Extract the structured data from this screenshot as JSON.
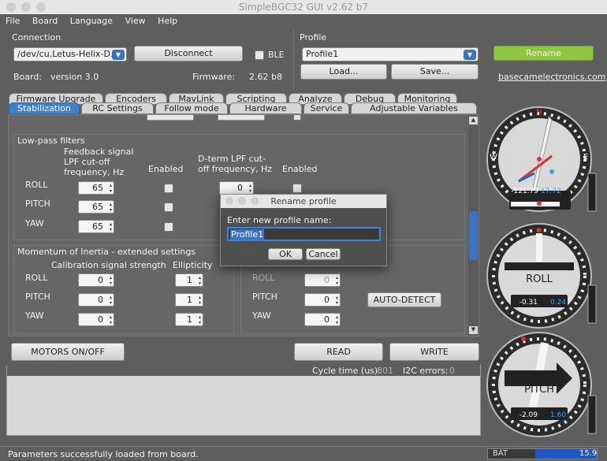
{
  "window": {
    "title": "SimpleBGC32 GUI v2.62 b7"
  },
  "menu": [
    "File",
    "Board",
    "Language",
    "View",
    "Help"
  ],
  "connection": {
    "label": "Connection",
    "port": "/dev/cu.Letus-Helix-D...",
    "disconnect": "Disconnect",
    "ble": "BLE",
    "board_label": "Board:",
    "board_value": "version 3.0",
    "firmware_label": "Firmware:",
    "firmware_value": "2.62 b8"
  },
  "profile": {
    "label": "Profile",
    "value": "Profile1",
    "load": "Load...",
    "save": "Save...",
    "rename": "Rename",
    "link": "basecamelectronics.com"
  },
  "tabs_back": [
    "Firmware Upgrade",
    "Encoders",
    "MavLink",
    "Scripting",
    "Analyze",
    "Debug",
    "Monitoring"
  ],
  "tabs_front": [
    "Stabilization",
    "RC Settings",
    "Follow mode",
    "Hardware",
    "Service",
    "Adjustable Variables"
  ],
  "lpf": {
    "title": "Low-pass filters",
    "col1": "Feedback signal LPF cut-off frequency, Hz",
    "col2": "Enabled",
    "col3": "D-term LPF cut-off frequency, Hz",
    "col4": "Enabled",
    "rows": [
      "ROLL",
      "PITCH",
      "YAW"
    ],
    "vals": [
      "65",
      "65",
      "65"
    ],
    "dval": "0"
  },
  "moi": {
    "title": "Momentum of Inertia - extended settings",
    "col1": "Calibration signal strength",
    "col2": "Ellipticity",
    "rows": [
      "ROLL",
      "PITCH",
      "YAW"
    ],
    "vals": [
      "0",
      "0",
      "0"
    ],
    "ell": [
      "1",
      "1",
      "1"
    ],
    "right_rows": [
      "ROLL",
      "PITCH",
      "YAW"
    ],
    "right_vals": [
      "0",
      "0",
      "0"
    ],
    "auto": "AUTO-DETECT"
  },
  "dialog": {
    "title": "Rename profile",
    "prompt": "Enter new profile name:",
    "value": "Profile1",
    "ok": "OK",
    "cancel": "Cancel"
  },
  "bottom": {
    "motors": "MOTORS ON/OFF",
    "read": "READ",
    "write": "WRITE",
    "cycle_label": "Cycle time (us):",
    "cycle_value": "801",
    "i2c_label": "I2C errors:",
    "i2c_value": "0"
  },
  "status": {
    "text": "Parameters successfully loaded from board.",
    "bat_label": "BAT",
    "bat_value": "15.9"
  },
  "gauges": {
    "yaw": {
      "a": "-121.79",
      "b": "17.72",
      "n": "N",
      "w": "W",
      "e": "E"
    },
    "roll": {
      "label": "ROLL",
      "a": "-0.31",
      "b": "0.24"
    },
    "pitch": {
      "label": "PITCH",
      "a": "-2.09",
      "b": "1.60"
    }
  },
  "colors": {
    "accent": "#8ec63f",
    "blue": "#29a8ff",
    "red": "#e03030"
  }
}
